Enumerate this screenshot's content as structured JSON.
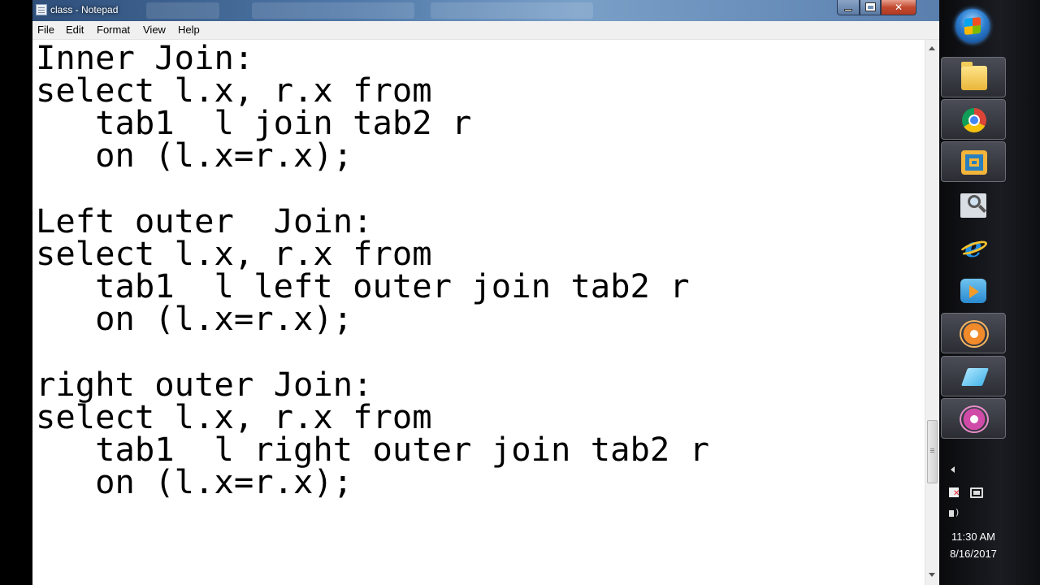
{
  "window": {
    "title": "class - Notepad",
    "close_glyph": "✕"
  },
  "menu": {
    "items": [
      "File",
      "Edit",
      "Format",
      "View",
      "Help"
    ]
  },
  "editor": {
    "lines": [
      "Inner Join:",
      "select l.x, r.x from",
      "   tab1  l join tab2 r",
      "   on (l.x=r.x);",
      "",
      "Left outer  Join:",
      "select l.x, r.x from",
      "   tab1  l left outer join tab2 r",
      "   on (l.x=r.x);",
      "",
      "right outer Join:",
      "select l.x, r.x from",
      "   tab1  l right outer join tab2 r",
      "   on (l.x=r.x);"
    ]
  },
  "taskbar": {
    "start_icon": "windows-logo",
    "apps": [
      {
        "name": "folder-icon",
        "active": true
      },
      {
        "name": "chrome-icon",
        "active": true
      },
      {
        "name": "vmware-icon",
        "active": true
      },
      {
        "name": "search-program-icon",
        "active": false
      },
      {
        "name": "internet-explorer-icon",
        "active": false
      },
      {
        "name": "media-player-icon",
        "active": false
      },
      {
        "name": "flower-app-icon",
        "active": true
      },
      {
        "name": "eraser-app-icon",
        "active": true
      },
      {
        "name": "flower-app-2-icon",
        "active": true
      }
    ],
    "tray": {
      "time": "11:30 AM",
      "date": "8/16/2017"
    }
  }
}
